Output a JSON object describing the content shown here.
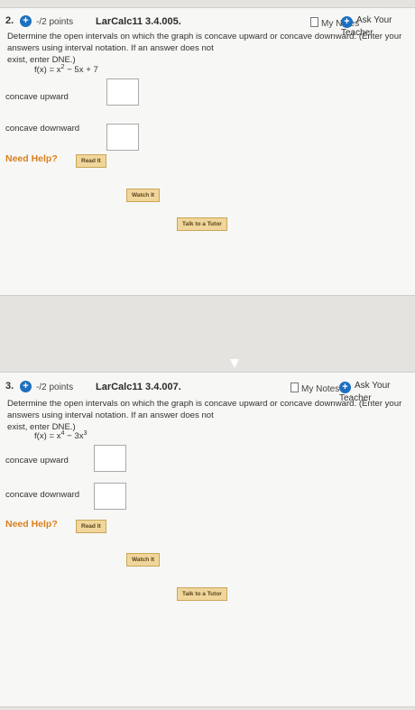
{
  "q2": {
    "number": "2.",
    "points": "-/2 points",
    "code": "LarCalc11 3.4.005.",
    "my_notes": "My Notes",
    "ask_teacher": "Ask Your Teacher",
    "question_line1": "Determine the open intervals on which the graph is concave upward or concave downward. (Enter your answers using interval notation. If an answer does not",
    "question_line2": "exist, enter DNE.)",
    "function_prefix": "f(x) = x",
    "function_exp": "2",
    "function_suffix": " − 5x + 7",
    "label_up": "concave upward",
    "label_down": "concave downward",
    "answer_up": "",
    "answer_down": "",
    "need_help": "Need Help?",
    "read_it": "Read It",
    "watch_it": "Watch It",
    "talk_tutor": "Talk to a Tutor"
  },
  "q3": {
    "number": "3.",
    "points": "-/2 points",
    "code": "LarCalc11 3.4.007.",
    "my_notes": "My Notes",
    "ask_teacher": "Ask Your Teacher",
    "question_line1": "Determine the open intervals on which the graph is concave upward or concave downward. (Enter your answers using interval notation. If an answer does not",
    "question_line2": "exist, enter DNE.)",
    "function_prefix": "f(x) = x",
    "function_exp1": "4",
    "function_mid": " − 3x",
    "function_exp2": "3",
    "label_up": "concave upward",
    "label_down": "concave downward",
    "answer_up": "",
    "answer_down": "",
    "need_help": "Need Help?",
    "read_it": "Read It",
    "watch_it": "Watch It",
    "talk_tutor": "Talk to a Tutor"
  },
  "icons": {
    "add": "plus-circle-icon",
    "notes": "notes-icon",
    "cursor": "mouse-pointer-icon"
  },
  "colors": {
    "accent_blue": "#1e6fbf",
    "need_help_orange": "#d9801e",
    "button_fill": "#f0d69a"
  }
}
